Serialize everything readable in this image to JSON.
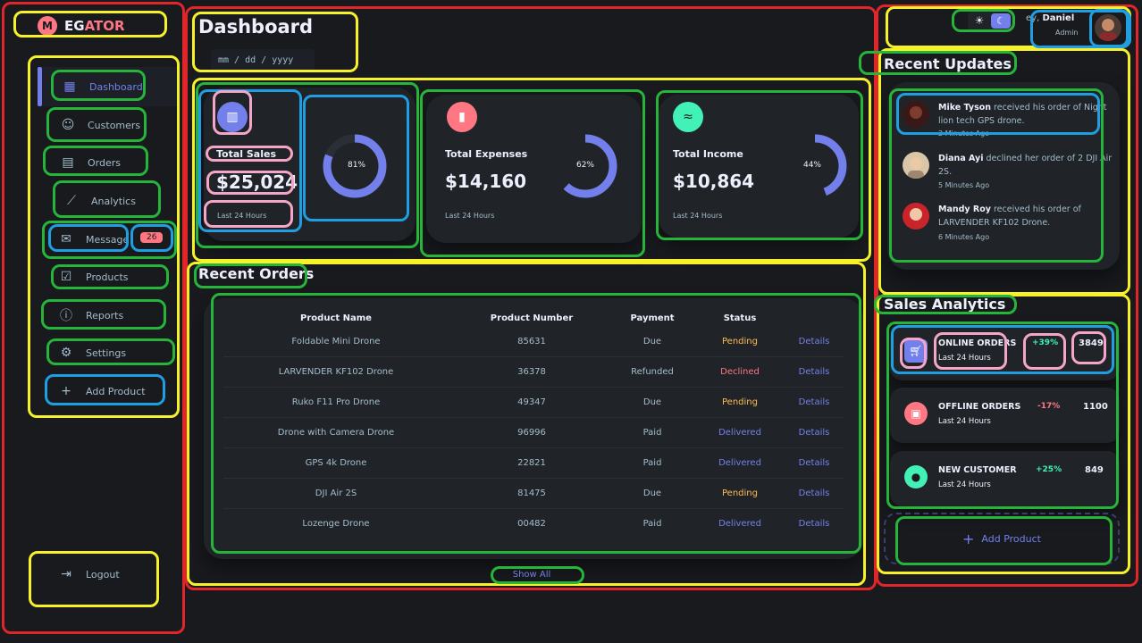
{
  "brand": {
    "part1": "EG",
    "part2": "ATOR",
    "mark": "M"
  },
  "nav": {
    "dashboard": "Dashboard",
    "customers": "Customers",
    "orders": "Orders",
    "analytics": "Analytics",
    "messages": "Message",
    "messages_badge": "26",
    "products": "Products",
    "reports": "Reports",
    "settings": "Settings",
    "add_product": "Add Product",
    "logout": "Logout"
  },
  "header": {
    "title": "Dashboard",
    "date_placeholder": "mm / dd / yyyy"
  },
  "insights": [
    {
      "title": "Total Sales",
      "amount": "$25,024",
      "period": "Last 24 Hours",
      "percent_label": "81%",
      "percent": 81,
      "icon": "analytics-icon",
      "color": "#7380ec"
    },
    {
      "title": "Total Expenses",
      "amount": "$14,160",
      "period": "Last 24 Hours",
      "percent_label": "62%",
      "percent": 62,
      "icon": "bar-chart-icon",
      "color": "#ff7782"
    },
    {
      "title": "Total Income",
      "amount": "$10,864",
      "period": "Last 24 Hours",
      "percent_label": "44%",
      "percent": 44,
      "icon": "stacked-line-chart-icon",
      "color": "#41f1b6"
    }
  ],
  "recent_orders": {
    "title": "Recent Orders",
    "columns": [
      "Product Name",
      "Product Number",
      "Payment",
      "Status",
      ""
    ],
    "rows": [
      {
        "name": "Foldable Mini Drone",
        "number": "85631",
        "payment": "Due",
        "status": "Pending",
        "link": "Details"
      },
      {
        "name": "LARVENDER KF102 Drone",
        "number": "36378",
        "payment": "Refunded",
        "status": "Declined",
        "link": "Details"
      },
      {
        "name": "Ruko F11 Pro Drone",
        "number": "49347",
        "payment": "Due",
        "status": "Pending",
        "link": "Details"
      },
      {
        "name": "Drone with Camera Drone",
        "number": "96996",
        "payment": "Paid",
        "status": "Delivered",
        "link": "Details"
      },
      {
        "name": "GPS 4k Drone",
        "number": "22821",
        "payment": "Paid",
        "status": "Delivered",
        "link": "Details"
      },
      {
        "name": "DJI Air 2S",
        "number": "81475",
        "payment": "Due",
        "status": "Pending",
        "link": "Details"
      },
      {
        "name": "Lozenge Drone",
        "number": "00482",
        "payment": "Paid",
        "status": "Delivered",
        "link": "Details"
      }
    ],
    "show_all": "Show All"
  },
  "status_colors": {
    "Pending": "#ffbb55",
    "Declined": "#ff7782",
    "Delivered": "#7380ec"
  },
  "profile": {
    "greeting": "ey,",
    "name": "Daniel",
    "role": "Admin"
  },
  "recent_updates": {
    "title": "Recent Updates",
    "items": [
      {
        "name": "Mike Tyson",
        "text": " received his order of Night lion tech GPS drone.",
        "time": "2 Minutes Ago"
      },
      {
        "name": "Diana Ayi",
        "text": " declined her order of 2 DJI Air 2S.",
        "time": "5 Minutes Ago"
      },
      {
        "name": "Mandy Roy",
        "text": " received his order of LARVENDER KF102 Drone.",
        "time": "6 Minutes Ago"
      }
    ]
  },
  "sales_analytics": {
    "title": "Sales Analytics",
    "items": [
      {
        "title": "ONLINE ORDERS",
        "period": "Last 24 Hours",
        "change": "+39%",
        "value": "3849",
        "icon": "shopping-cart-icon",
        "color": "#7380ec",
        "change_color": "#41f1b6"
      },
      {
        "title": "OFFLINE ORDERS",
        "period": "Last 24 Hours",
        "change": "-17%",
        "value": "1100",
        "icon": "local-mall-icon",
        "color": "#ff7782",
        "change_color": "#ff7782"
      },
      {
        "title": "NEW CUSTOMER",
        "period": "Last 24 Hours",
        "change": "+25%",
        "value": "849",
        "icon": "person-icon",
        "color": "#41f1b6",
        "change_color": "#41f1b6"
      }
    ],
    "add_product": "Add Product"
  }
}
